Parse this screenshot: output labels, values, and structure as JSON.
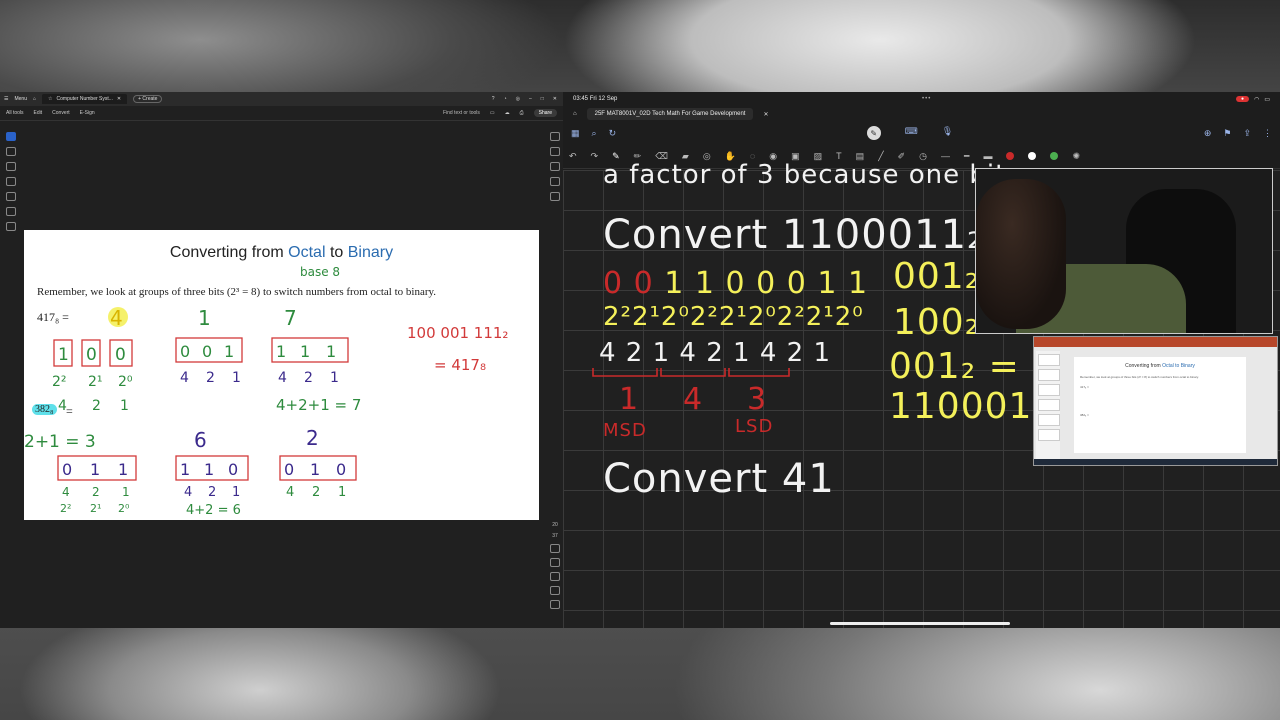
{
  "pdf": {
    "menu_label": "Menu",
    "tab_title": "Computer Number Syst...",
    "create_label": "+ Create",
    "menubar": [
      "All tools",
      "Edit",
      "Convert",
      "E-Sign"
    ],
    "find_label": "Find text or tools",
    "share_label": "Share",
    "page_number": "20",
    "page_total": "37"
  },
  "slide": {
    "title_prefix": "Converting from ",
    "title_octal": "Octal",
    "title_mid": " to ",
    "title_binary": "Binary",
    "body": "Remember, we look at groups of three bits (2³ = 8) to switch numbers from octal to binary.",
    "eq1": "417₈ =",
    "eq2_highlight": "382₈",
    "eq2_suffix": "="
  },
  "annotations": {
    "base8": "base 8",
    "digit_4": "4",
    "digit_1": "1",
    "digit_7": "7",
    "group_4": [
      "1",
      "0",
      "0"
    ],
    "group_1": [
      "0",
      "0",
      "1"
    ],
    "group_7": [
      "1",
      "1",
      "1"
    ],
    "powers_4": [
      "2²",
      "2¹",
      "2⁰"
    ],
    "weights": [
      "4",
      "2",
      "1"
    ],
    "weights_sub": [
      "4",
      "2",
      "1"
    ],
    "result_line": "100 001 111₂",
    "result_eq": "= 417₈",
    "sum_7": "4+2+1 = 7",
    "sum_3": "2+1 = 3",
    "digit_6": "6",
    "digit_2": "2",
    "group_3": [
      "0",
      "1",
      "1"
    ],
    "group_6": [
      "1",
      "1",
      "0"
    ],
    "group_2": [
      "0",
      "1",
      "0"
    ],
    "powers_3": [
      "2²",
      "2¹",
      "2⁰"
    ],
    "sum_6": "4+2 = 6"
  },
  "goodnotes": {
    "time": "03:45",
    "date": "Fri 12 Sep",
    "dots": "•••",
    "rec_icon": "●",
    "doc_tab": "25F MAT8001V_02D Tech Math For Game Development",
    "note_top": "a factor of 3 because one bit",
    "convert1": "Convert 1100011₂ to oct",
    "bits_row": "0 0 1 1 0 0 0 1 1",
    "powers_row": "2²2¹2⁰2²2¹2⁰2²2¹2⁰",
    "weights_row": "4 2 1 4 2 1 4 2 1",
    "octal_digits": [
      "1",
      "4",
      "3"
    ],
    "msd": "MSD",
    "lsd": "LSD",
    "convert2": "Convert 41",
    "right_lines": [
      "001₂ =",
      "100₂ =",
      "001₂ = 0t",
      "1100011₂"
    ]
  },
  "thumb": {
    "title_prefix": "Converting from ",
    "title_highlight": "Octal to Binary",
    "line": "Remember, we look at groups of three bits (2³ = 8) to switch numbers from octal to binary.",
    "eq": "417₈ =",
    "eq2": "382₈ ="
  },
  "colors": {
    "red_ink": "#d23a3a",
    "green_ink": "#2e8b3e",
    "purple_ink": "#3b2a8c",
    "yellow_ink": "#f4f05a",
    "white_ink": "#f2f2f2",
    "red_note": "#c92a2a"
  }
}
